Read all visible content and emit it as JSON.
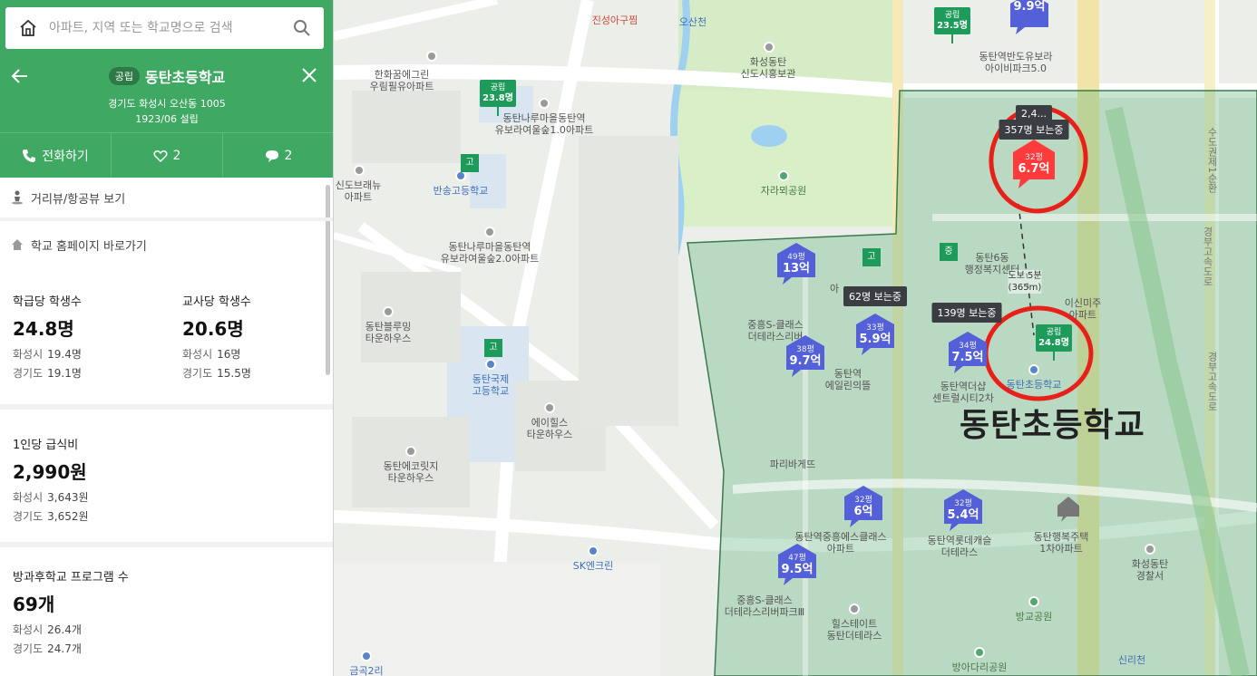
{
  "search": {
    "placeholder": "아파트, 지역 또는 학교명으로 검색"
  },
  "school": {
    "badge": "공립",
    "name": "동탄초등학교",
    "address": "경기도 화성시 오산동 1005",
    "founded": "1923/06 설립"
  },
  "actions": {
    "call": "전화하기",
    "likes": "2",
    "comments": "2"
  },
  "links": {
    "street_view": "거리뷰/항공뷰 보기",
    "homepage": "학교 홈페이지 바로가기"
  },
  "stats": {
    "per_class": {
      "label": "학급당 학생수",
      "value": "24.8명",
      "city_k": "화성시",
      "city_v": "19.4명",
      "prov_k": "경기도",
      "prov_v": "19.1명"
    },
    "per_teacher": {
      "label": "교사당 학생수",
      "value": "20.6명",
      "city_k": "화성시",
      "city_v": "16명",
      "prov_k": "경기도",
      "prov_v": "15.5명"
    },
    "meal": {
      "label": "1인당 급식비",
      "value": "2,990원",
      "city_k": "화성시",
      "city_v": "3,643원",
      "prov_k": "경기도",
      "prov_v": "3,652원"
    },
    "after": {
      "label": "방과후학교 프로그램 수",
      "value": "69개",
      "city_k": "화성시",
      "city_v": "26.4개",
      "prov_k": "경기도",
      "prov_v": "24.7개"
    }
  },
  "map": {
    "labels": {
      "jinsung": "진성아구찜",
      "osancheon": "오산천",
      "museum": "화성동탄\n신도시홍보관",
      "hanwha": "한화꿈에그린\n우림필유아파트",
      "bora": "동탄나루마을동탄역\n유보라여울숲1.0아파트",
      "sindo": "신도브래뉴\n아파트",
      "bansong": "반송고등학교",
      "bora2": "동탄나루마을동탄역\n유보라여울숲2.0아파트",
      "bloom": "동탄블루밍\n타운하우스",
      "intl": "동탄국제\n고등학교",
      "ahills": "에이힐스\n타운하우스",
      "ecoritz": "동탄에코릿지\n타운하우스",
      "sk": "SK엔크린",
      "geumgok": "금곡2리",
      "jara": "자라뫼공원",
      "iparkbora": "동탄역반도유보라\n아이비파크5.0",
      "dong6": "동탄6동\n행정복지센터",
      "eunsan": "이신미주\n아파트",
      "sclass1": "중흥S-클래스\n더테라스리버",
      "elin": "동탄역\n에일린의뜰",
      "centreal": "동탄역더샵\n센트럴시티2차",
      "school": "동탄초등학교",
      "paris": "파리바게뜨",
      "sclass2": "동탄역중흥에스클래스\n아파트",
      "hyde": "동탄역롯데캐슬\n더테라스",
      "haengbok": "동탄행복주택\n1차아파트",
      "police": "화성동탄\n경찰서",
      "banggyo": "방교공원",
      "sclass3": "중흥S-클래스\n더테라스리버파크Ⅲ",
      "hillstate": "힐스테이트\n동탄더테라스",
      "banga": "방아다리공원",
      "sinri": "신리천",
      "road1": "수도권제1순환",
      "road2": "경부고속도로",
      "road3": "경부고속도로",
      "ai": "아"
    },
    "price_markers": [
      {
        "size": "49평",
        "price": "13억"
      },
      {
        "size": "33평",
        "price": "5.9억"
      },
      {
        "size": "38평",
        "price": "9.7억"
      },
      {
        "size": "34평",
        "price": "7.5억"
      },
      {
        "size": "32평",
        "price": "6억"
      },
      {
        "size": "32평",
        "price": "5.4억"
      },
      {
        "size": "47평",
        "price": "9.5억"
      },
      {
        "size": "",
        "price": "9.9억"
      }
    ],
    "target": {
      "size": "32평",
      "price": "6.7억",
      "viewers": "357명 보는중",
      "viewers_top": "2,4..."
    },
    "flags": [
      {
        "type": "공립",
        "value": "23.5명"
      },
      {
        "type": "공립",
        "value": "23.8명"
      },
      {
        "type": "공립",
        "value": "24.8명"
      }
    ],
    "high": {
      "a": "고",
      "b": "고",
      "c": "고",
      "d": "중"
    },
    "viewers_1": "62명 보는중",
    "viewers_2": "139명 보는중",
    "walk": "도보 5분\n(365m)",
    "big_label": "동탄초등학교",
    "colors": {
      "green": "#3fa862",
      "price": "#5460d8",
      "target": "#ff3b3b",
      "circle": "#e8201a"
    }
  }
}
